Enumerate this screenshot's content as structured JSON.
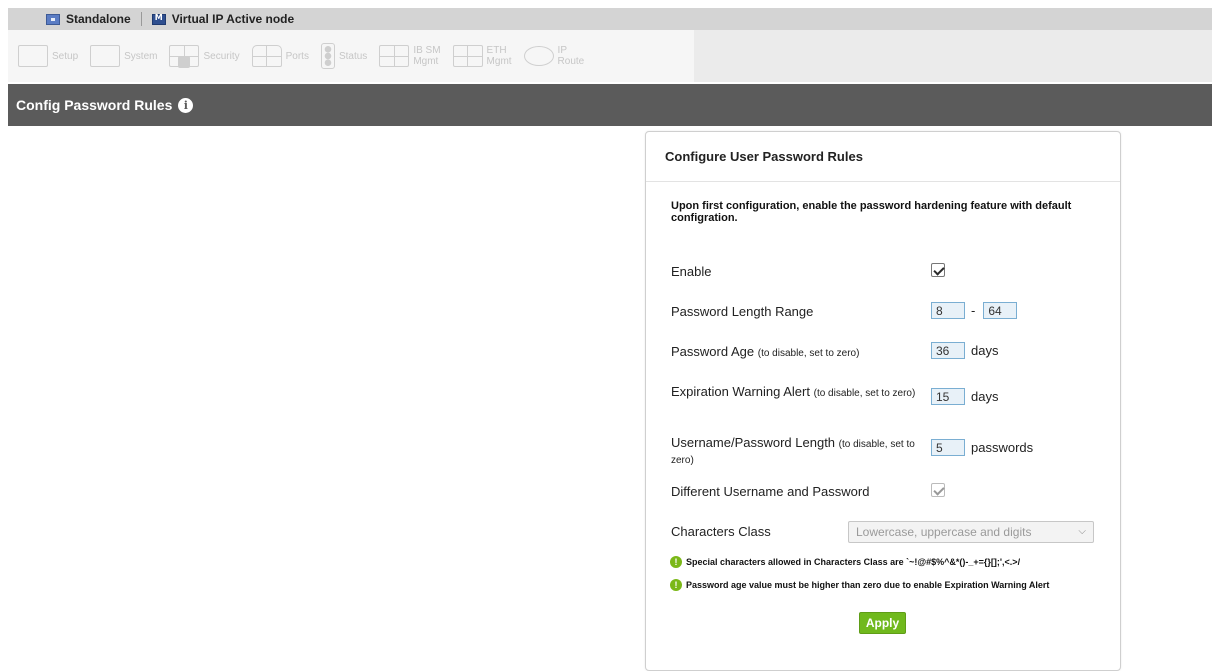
{
  "topbar": {
    "standalone_label": "Standalone",
    "vip_label": "Virtual IP Active node"
  },
  "nav": {
    "items": [
      {
        "label": "Setup",
        "icon": "setup-icon"
      },
      {
        "label": "System",
        "icon": "system-icon"
      },
      {
        "label": "Security",
        "icon": "security-icon"
      },
      {
        "label": "Ports",
        "icon": "ports-icon"
      },
      {
        "label": "Status",
        "icon": "status-icon"
      },
      {
        "label": "IB SM",
        "label2": "Mgmt",
        "icon": "ib-sm-mgmt-icon"
      },
      {
        "label": "ETH",
        "label2": "Mgmt",
        "icon": "eth-mgmt-icon"
      },
      {
        "label": "IP",
        "label2": "Route",
        "icon": "ip-route-icon"
      }
    ]
  },
  "page": {
    "title": "Config Password Rules",
    "info_glyph": "i"
  },
  "panel": {
    "header": "Configure User Password Rules",
    "intro": "Upon first configuration, enable the password hardening feature with default configration.",
    "enable": {
      "label": "Enable",
      "checked": true
    },
    "length_range": {
      "label": "Password Length Range",
      "min": "8",
      "dash": "-",
      "max": "64"
    },
    "age": {
      "label": "Password Age",
      "hint": "(to disable, set to zero)",
      "value": "36",
      "unit": "days"
    },
    "expiration": {
      "label": "Expiration Warning Alert",
      "hint": "(to disable, set to zero)",
      "value": "15",
      "unit": "days"
    },
    "username_length": {
      "label": "Username/Password Length",
      "hint": "(to disable, set to zero)",
      "value": "5",
      "unit": "passwords"
    },
    "different": {
      "label": "Different Username and Password",
      "checked": true
    },
    "char_class": {
      "label": "Characters Class",
      "selected": "Lowercase, uppercase and digits"
    },
    "note1": "Special characters allowed in Characters Class are `~!@#$%^&*()-_+={}[];',<.>/",
    "note2": "Password age value must be higher than zero due to enable Expiration Warning Alert",
    "note_glyph": "!",
    "apply_label": "Apply"
  },
  "colors": {
    "titlebar": "#5b5b5b",
    "apply": "#70b91d",
    "warn": "#7bb818",
    "input_border": "#7aaed2"
  }
}
